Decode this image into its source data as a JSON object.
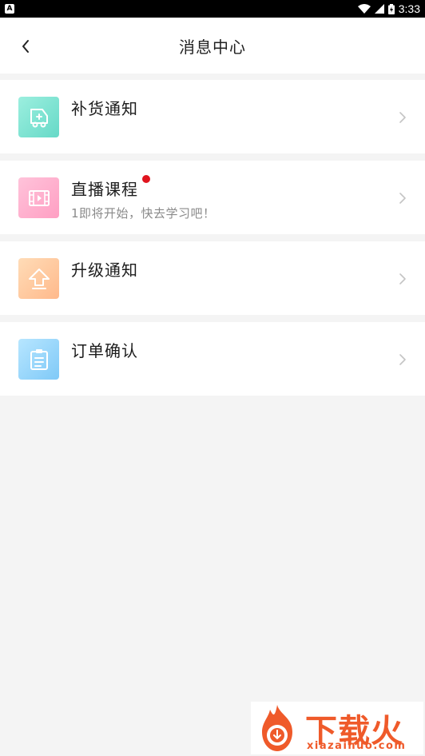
{
  "status_bar": {
    "time": "3:33",
    "app_icon_letter": "A",
    "icons": [
      "wifi-icon",
      "cell-signal-icon",
      "battery-icon"
    ]
  },
  "header": {
    "title": "消息中心",
    "back_icon": "chevron-left-icon"
  },
  "messages": [
    {
      "title": "补货通知",
      "subtitle": "",
      "icon": "delivery-truck-icon",
      "icon_color": "#66d9c7",
      "unread": false
    },
    {
      "title": "直播课程",
      "subtitle": "1即将开始，快去学习吧！",
      "icon": "video-film-icon",
      "icon_color": "#ff9fc3",
      "unread": true
    },
    {
      "title": "升级通知",
      "subtitle": "",
      "icon": "upgrade-arrow-icon",
      "icon_color": "#ffb98b",
      "unread": false
    },
    {
      "title": "订单确认",
      "subtitle": "",
      "icon": "clipboard-icon",
      "icon_color": "#7fc9f7",
      "unread": false
    }
  ],
  "watermark": {
    "brand": "下载火",
    "url": "xiazaihuo.com",
    "color": "#ef5a2a"
  },
  "colors": {
    "background": "#f4f4f4",
    "unread_dot": "#e0141e"
  }
}
